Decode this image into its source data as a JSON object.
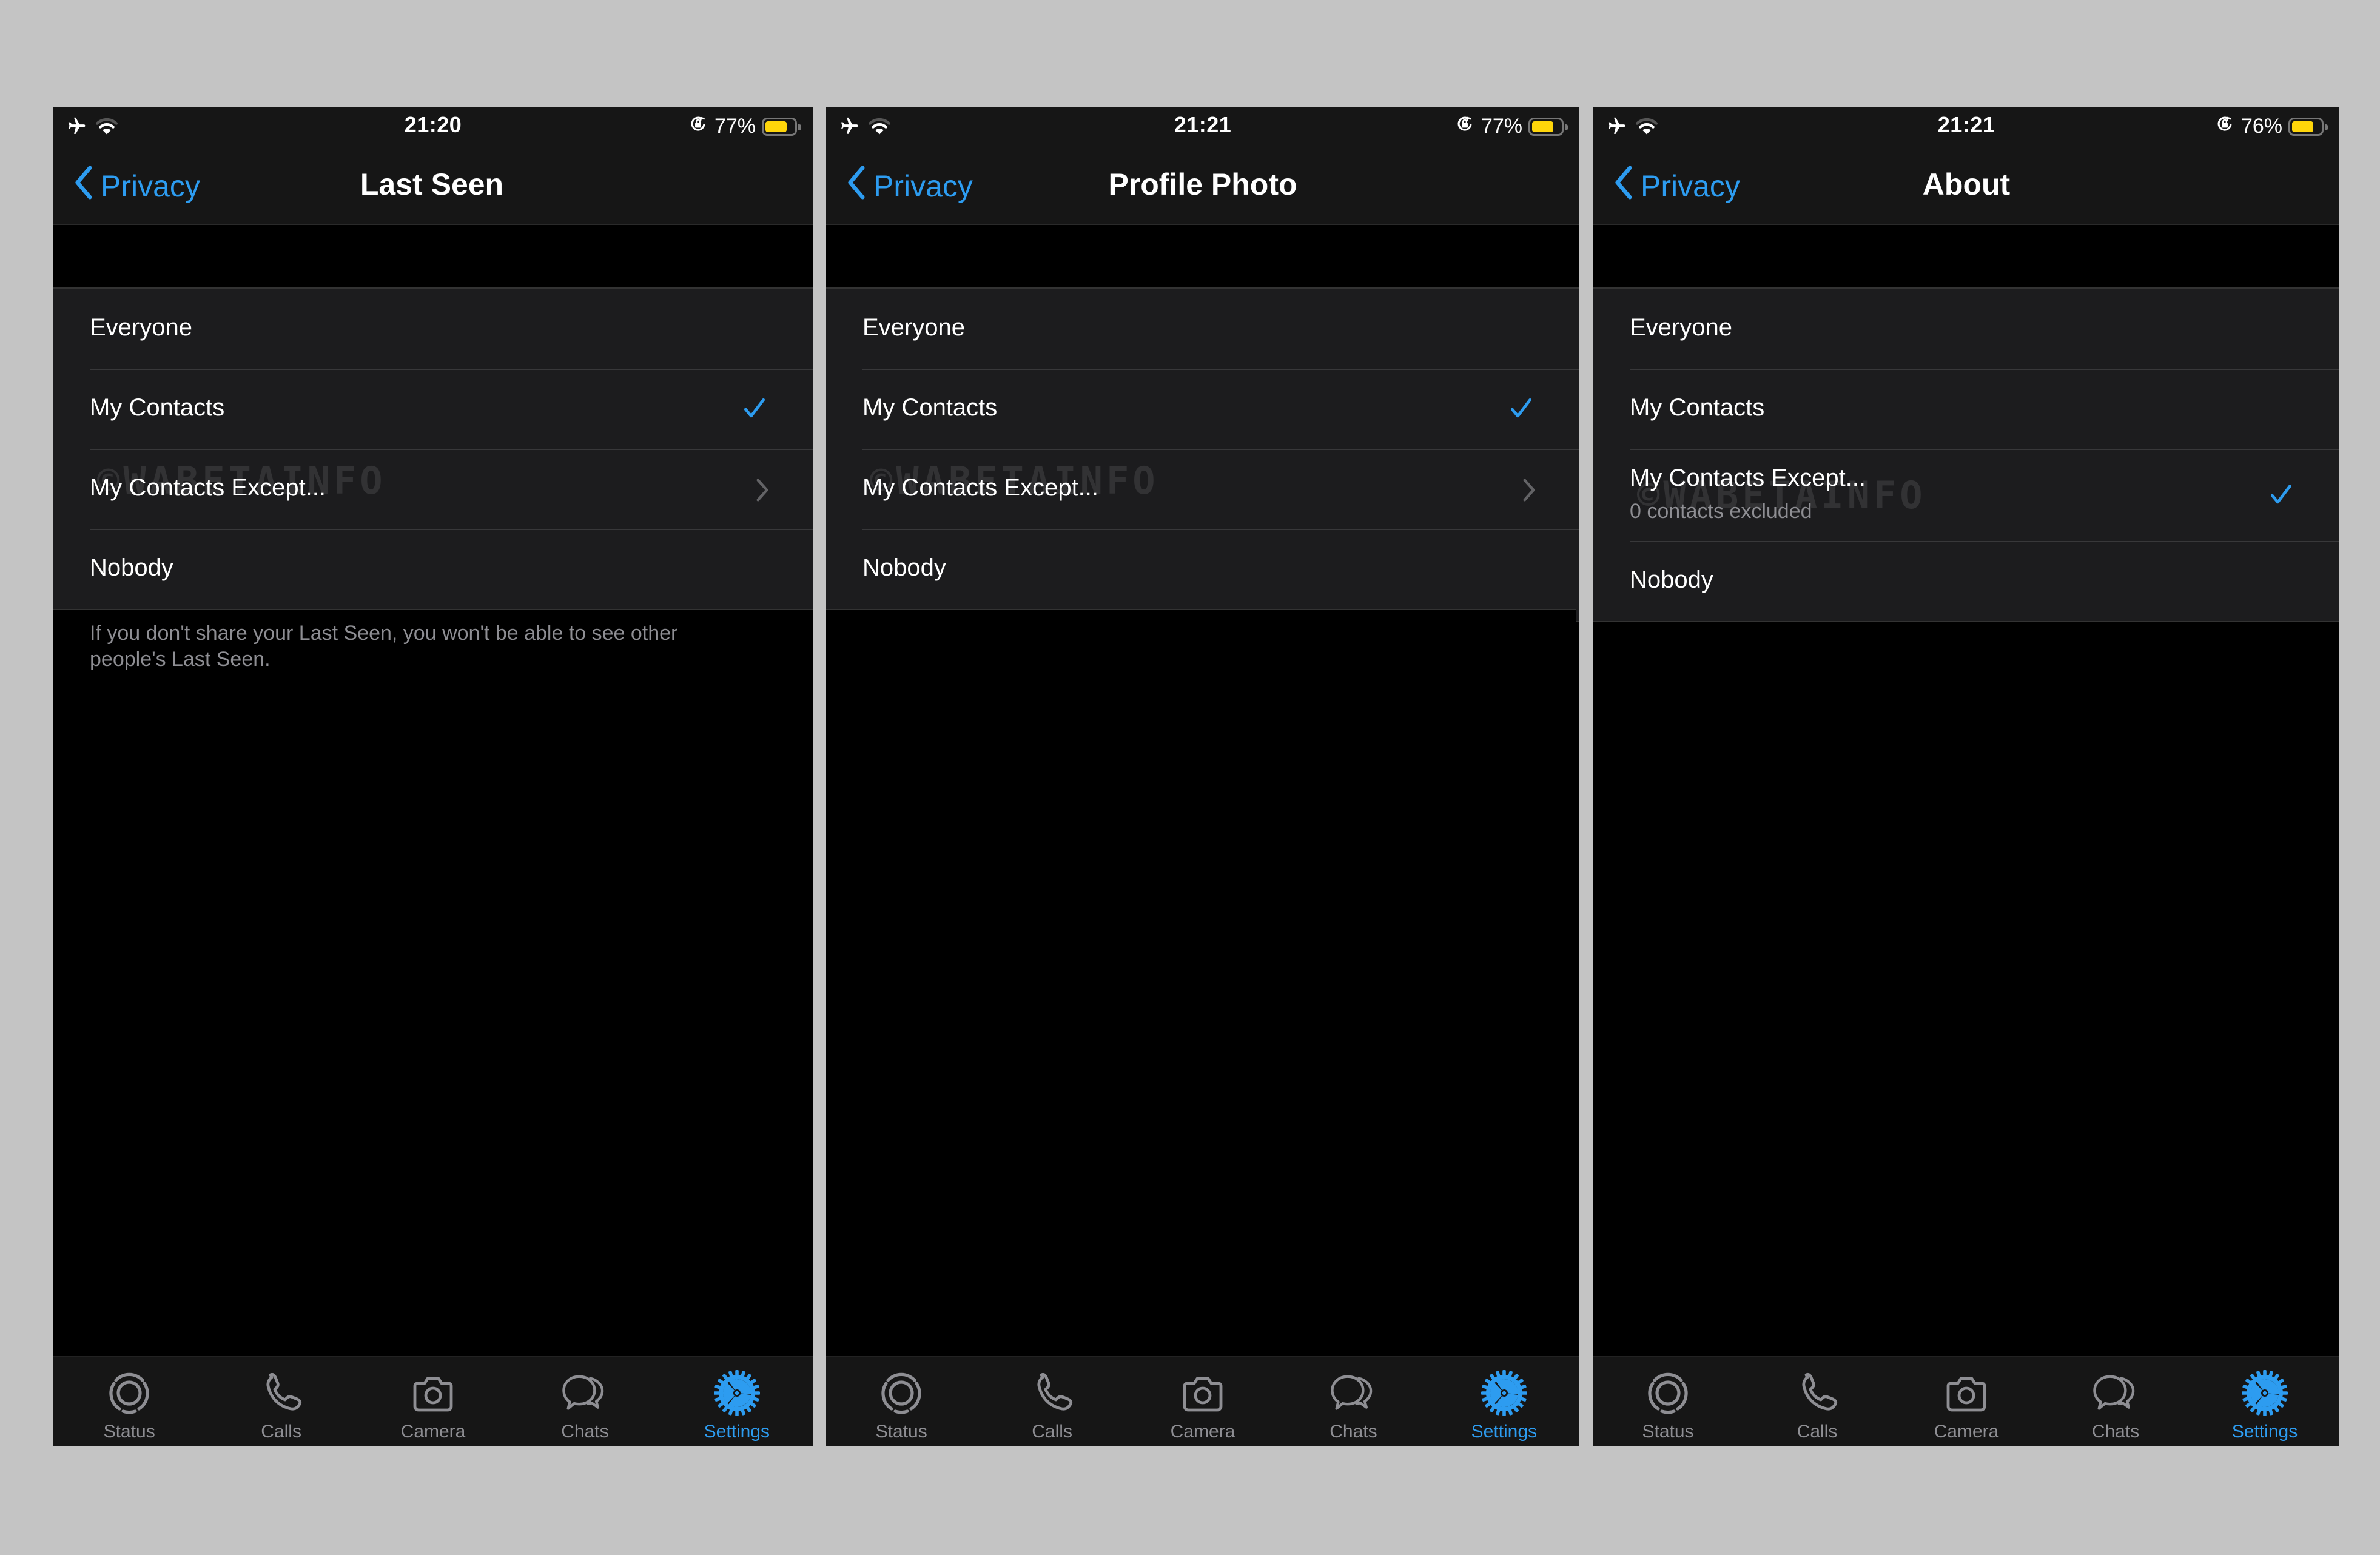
{
  "accent_color": "#2d9cf0",
  "watermark": "©WABETAINFO",
  "screens": [
    {
      "status": {
        "time": "21:20",
        "battery_text": "77%",
        "battery_level": 0.77
      },
      "nav": {
        "back_label": "Privacy",
        "title": "Last Seen"
      },
      "options": [
        {
          "label": "Everyone",
          "sublabel": "",
          "selected": false,
          "has_chevron": false
        },
        {
          "label": "My Contacts",
          "sublabel": "",
          "selected": true,
          "has_chevron": false
        },
        {
          "label": "My Contacts Except...",
          "sublabel": "",
          "selected": false,
          "has_chevron": true
        },
        {
          "label": "Nobody",
          "sublabel": "",
          "selected": false,
          "has_chevron": false
        }
      ],
      "footer_note": "If you don't share your Last Seen, you won't be able to see other people's Last Seen."
    },
    {
      "status": {
        "time": "21:21",
        "battery_text": "77%",
        "battery_level": 0.77
      },
      "nav": {
        "back_label": "Privacy",
        "title": "Profile Photo"
      },
      "options": [
        {
          "label": "Everyone",
          "sublabel": "",
          "selected": false,
          "has_chevron": false
        },
        {
          "label": "My Contacts",
          "sublabel": "",
          "selected": true,
          "has_chevron": false
        },
        {
          "label": "My Contacts Except...",
          "sublabel": "",
          "selected": false,
          "has_chevron": true
        },
        {
          "label": "Nobody",
          "sublabel": "",
          "selected": false,
          "has_chevron": false
        }
      ],
      "footer_note": ""
    },
    {
      "status": {
        "time": "21:21",
        "battery_text": "76%",
        "battery_level": 0.76
      },
      "nav": {
        "back_label": "Privacy",
        "title": "About"
      },
      "options": [
        {
          "label": "Everyone",
          "sublabel": "",
          "selected": false,
          "has_chevron": false
        },
        {
          "label": "My Contacts",
          "sublabel": "",
          "selected": false,
          "has_chevron": false
        },
        {
          "label": "My Contacts Except...",
          "sublabel": "0 contacts excluded",
          "selected": true,
          "has_chevron": false
        },
        {
          "label": "Nobody",
          "sublabel": "",
          "selected": false,
          "has_chevron": false
        }
      ],
      "footer_note": ""
    }
  ],
  "tabbar": {
    "items": [
      {
        "label": "Status",
        "icon": "status-icon",
        "active": false
      },
      {
        "label": "Calls",
        "icon": "phone-icon",
        "active": false
      },
      {
        "label": "Camera",
        "icon": "camera-icon",
        "active": false
      },
      {
        "label": "Chats",
        "icon": "chat-bubbles-icon",
        "active": false
      },
      {
        "label": "Settings",
        "icon": "gear-icon",
        "active": true
      }
    ]
  }
}
